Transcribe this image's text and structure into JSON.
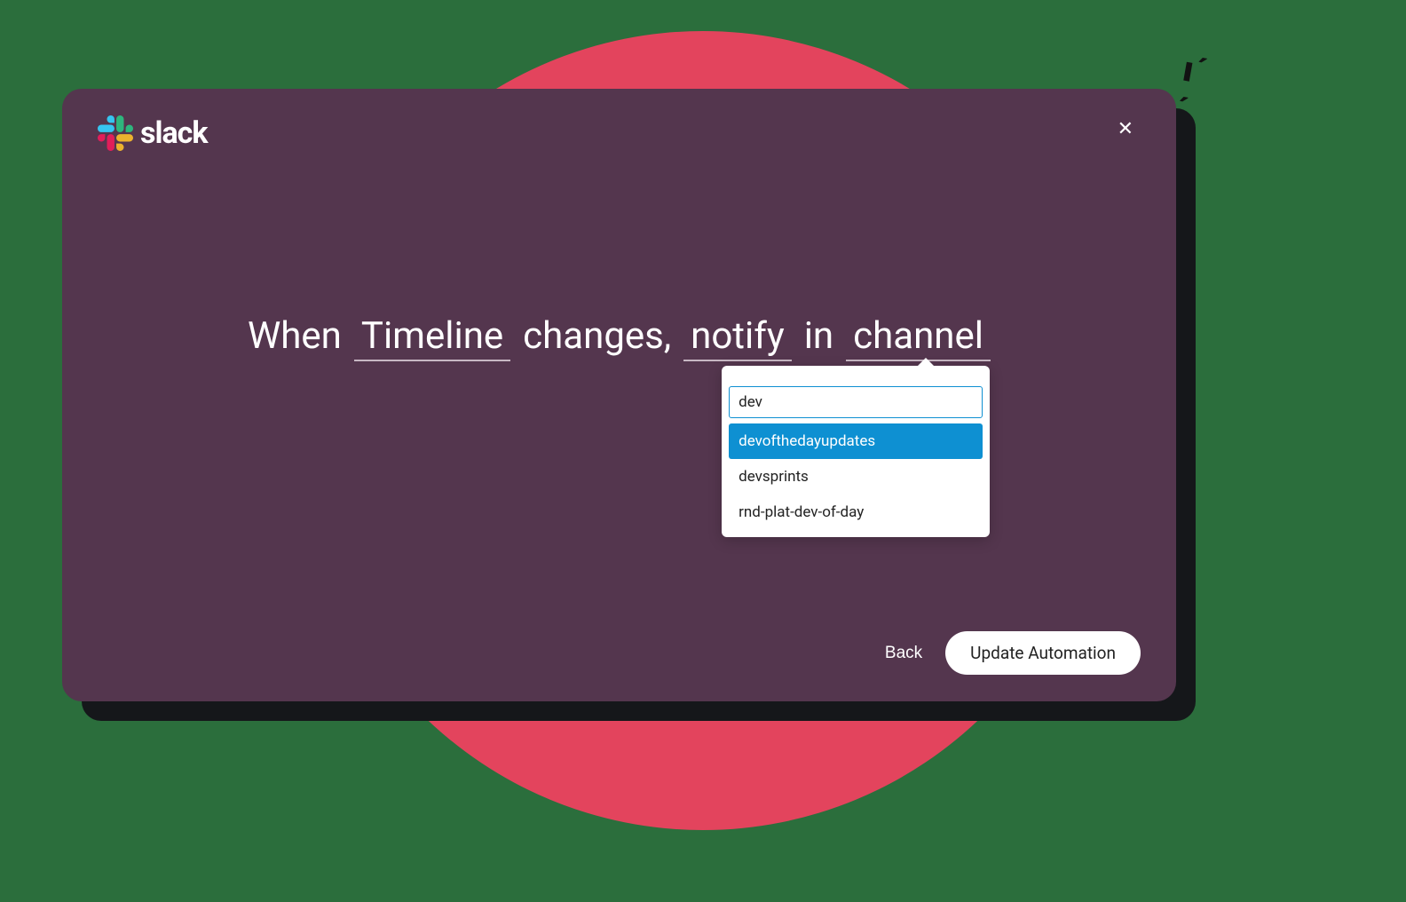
{
  "brand": {
    "name": "slack"
  },
  "modal": {
    "close_label": "✕"
  },
  "sentence": {
    "part1": "When",
    "fill1": "Timeline",
    "part2": "changes,",
    "fill2": "notify",
    "part3": "in",
    "fill3": "channel"
  },
  "dropdown": {
    "search_value": "dev",
    "items": [
      {
        "label": "devofthedayupdates",
        "selected": true
      },
      {
        "label": "devsprints",
        "selected": false
      },
      {
        "label": "rnd-plat-dev-of-day",
        "selected": false
      }
    ]
  },
  "footer": {
    "back_label": "Back",
    "primary_label": "Update Automation"
  }
}
